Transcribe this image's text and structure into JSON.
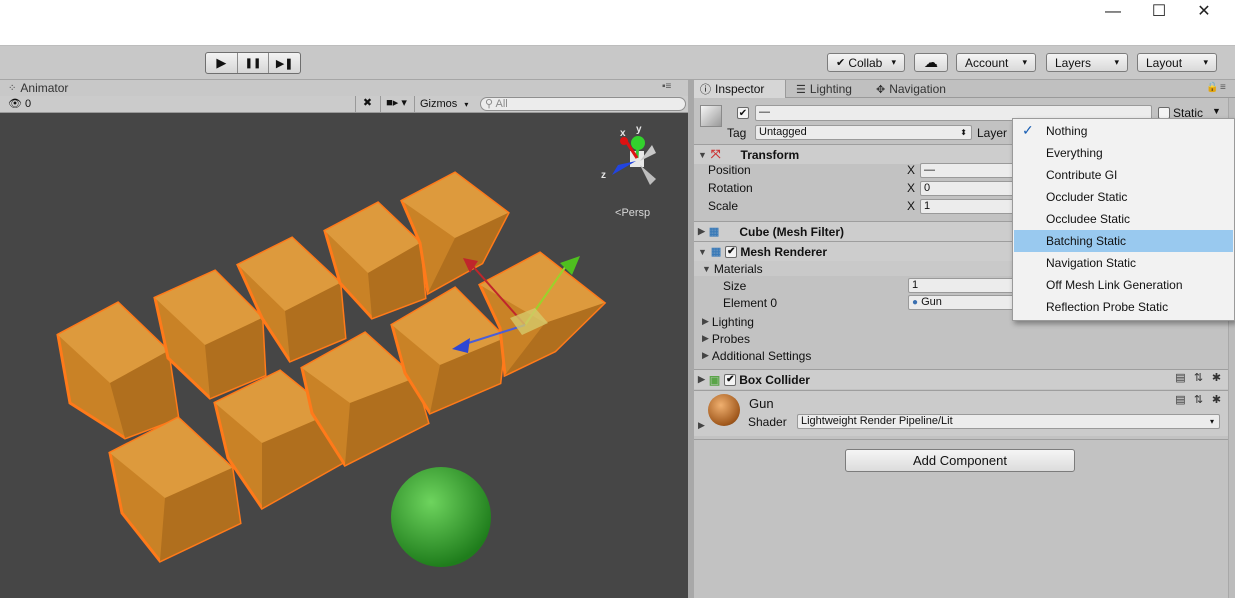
{
  "window": {
    "minimize": "—",
    "maximize": "☐",
    "close": "✕"
  },
  "toolbar": {
    "play": "▶",
    "pause": "❚❚",
    "step": "▶❚",
    "collab": "Collab",
    "cloud": "☁",
    "account": "Account",
    "layers": "Layers",
    "layout": "Layout"
  },
  "scene": {
    "tab_label": "Animator",
    "visibility_count": "0",
    "gizmos": "Gizmos",
    "search_placeholder": "All",
    "persp_label": "Persp",
    "axis_y": "y",
    "axis_x": "x",
    "axis_z": "z"
  },
  "inspector": {
    "tabs": [
      "Inspector",
      "Lighting",
      "Navigation"
    ],
    "object_name": "—",
    "static_label": "Static",
    "tag_label": "Tag",
    "tag_value": "Untagged",
    "layer_label": "Layer",
    "transform": {
      "title": "Transform",
      "position_label": "Position",
      "position_x": "—",
      "rotation_label": "Rotation",
      "rotation_x": "0",
      "scale_label": "Scale",
      "scale_x": "1",
      "x_label": "X"
    },
    "mesh_filter": {
      "title": "Cube (Mesh Filter)"
    },
    "mesh_renderer": {
      "title": "Mesh Renderer",
      "materials": "Materials",
      "size_label": "Size",
      "size_value": "1",
      "element0_label": "Element 0",
      "element0_value": "Gun",
      "lighting": "Lighting",
      "probes": "Probes",
      "additional": "Additional Settings"
    },
    "box_collider": {
      "title": "Box Collider"
    },
    "material": {
      "name": "Gun",
      "shader_label": "Shader",
      "shader_value": "Lightweight Render Pipeline/Lit"
    },
    "add_component": "Add Component"
  },
  "static_dropdown": {
    "items": [
      "Nothing",
      "Everything",
      "Contribute GI",
      "Occluder Static",
      "Occludee Static",
      "Batching Static",
      "Navigation Static",
      "Off Mesh Link Generation",
      "Reflection Probe Static"
    ],
    "checked": "Nothing",
    "highlighted": "Batching Static",
    "checkmark": "✓"
  },
  "colors": {
    "cube_fill": "#d08a2a",
    "cube_outline": "#ff7a1a",
    "sphere": "#2ea82a",
    "scene_bg": "#464646",
    "highlight": "#99c9ef"
  }
}
